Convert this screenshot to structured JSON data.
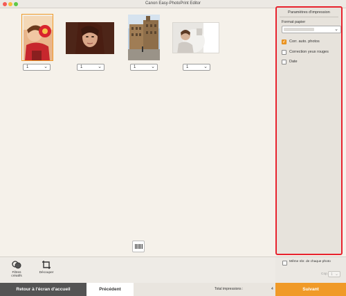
{
  "window": {
    "title": "Canon Easy-PhotoPrint Editor"
  },
  "photos": [
    {
      "qty": "1",
      "description": "child with red fan"
    },
    {
      "qty": "1",
      "description": "woman portrait"
    },
    {
      "qty": "1",
      "description": "city buildings"
    },
    {
      "qty": "1",
      "description": "girl in white"
    }
  ],
  "print_settings": {
    "title": "Paramètres d'impression",
    "paper_format_label": "Format papier",
    "paper_format_value": "",
    "options": [
      {
        "label": "Corr. auto. photos",
        "checked": true
      },
      {
        "label": "Correction yeux rouges",
        "checked": false
      },
      {
        "label": "Date",
        "checked": false
      }
    ]
  },
  "tools": {
    "filters_label": "Filtres créatifs",
    "crop_label": "Découper"
  },
  "same_count": {
    "label": "Même nbr. de chaque photo",
    "checked": false
  },
  "copies": {
    "label": "Cop.",
    "value": "1"
  },
  "footer": {
    "home_label": "Retour à l'écran d'accueil",
    "prev_label": "Précédent",
    "total_label": "Total impressions :",
    "total_value": "4",
    "next_label": "Suivant"
  },
  "colors": {
    "accent": "#f09a28",
    "highlight_border": "#e8222d",
    "dark_button": "#545454"
  }
}
